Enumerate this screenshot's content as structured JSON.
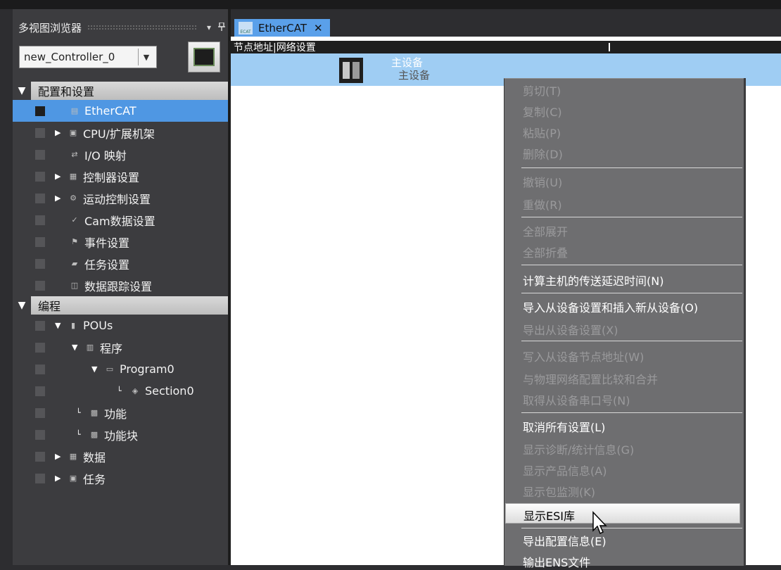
{
  "left_panel": {
    "title": "多视图浏览器",
    "pin_icon": "pin-icon",
    "controller_select": {
      "value": "new_Controller_0"
    },
    "tree": {
      "config_category": "配置和设置",
      "programming_category": "编程",
      "items": [
        {
          "label": "EtherCAT",
          "icon": "ethercat-icon"
        },
        {
          "label": "CPU/扩展机架",
          "icon": "rack-icon"
        },
        {
          "label": "I/O 映射",
          "icon": "io-map-icon"
        },
        {
          "label": "控制器设置",
          "icon": "controller-settings-icon"
        },
        {
          "label": "运动控制设置",
          "icon": "motion-gear-icon"
        },
        {
          "label": "Cam数据设置",
          "icon": "cam-icon"
        },
        {
          "label": "事件设置",
          "icon": "flag-icon"
        },
        {
          "label": "任务设置",
          "icon": "task-icon"
        },
        {
          "label": "数据跟踪设置",
          "icon": "trace-icon"
        },
        {
          "label": "POUs",
          "icon": "pou-icon"
        },
        {
          "label": "程序",
          "icon": "program-icon"
        },
        {
          "label": "Program0",
          "icon": "program0-icon"
        },
        {
          "label": "Section0",
          "icon": "section-icon"
        },
        {
          "label": "功能",
          "icon": "function-icon"
        },
        {
          "label": "功能块",
          "icon": "function-block-icon"
        },
        {
          "label": "数据",
          "icon": "data-icon"
        },
        {
          "label": "任务",
          "icon": "task-folder-icon"
        }
      ]
    }
  },
  "editor": {
    "tab_label": "EtherCAT",
    "header_label": "节点地址|网络设置",
    "master_device": {
      "name": "主设备",
      "sub": "主设备"
    }
  },
  "context_menu": {
    "items": [
      "剪切(T)",
      "复制(C)",
      "粘贴(P)",
      "删除(D)",
      "撤销(U)",
      "重做(R)",
      "全部展开",
      "全部折叠",
      "计算主机的传送延迟时间(N)",
      "导入从设备设置和插入新从设备(O)",
      "导出从设备设置(X)",
      "写入从设备节点地址(W)",
      "与物理网络配置比较和合并",
      "取得从设备串口号(N)",
      "取消所有设置(L)",
      "显示诊断/统计信息(G)",
      "显示产品信息(A)",
      "显示包监测(K)",
      "显示ESI库",
      "导出配置信息(E)",
      "输出ENS文件"
    ]
  },
  "colors": {
    "selection": "#4f97e3",
    "tab": "#5aa0ea",
    "master_row": "#9fcdf3",
    "menu_bg": "#6e6e70",
    "menu_disabled": "#9a9a9c"
  }
}
